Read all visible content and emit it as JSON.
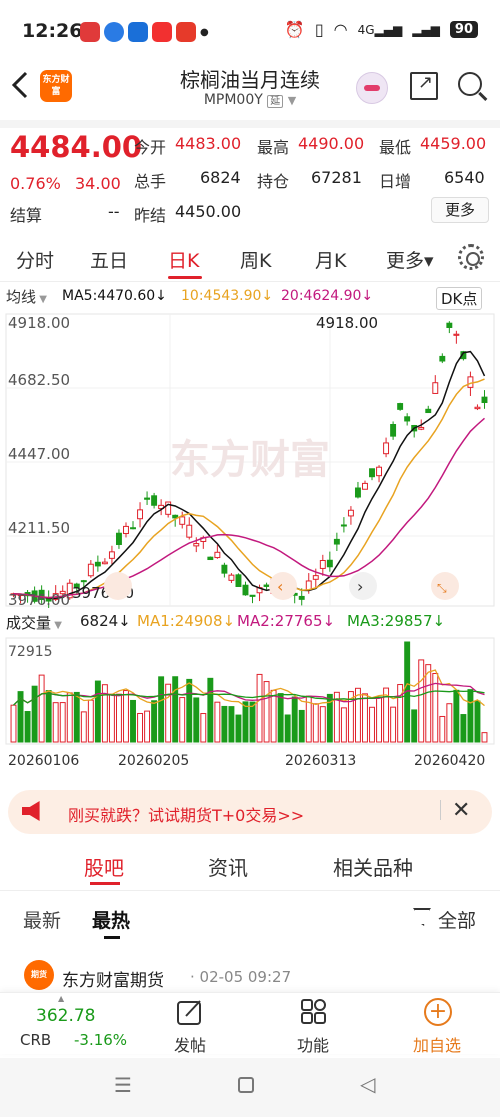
{
  "status": {
    "time": "12:26",
    "battery": "90",
    "network": "4G"
  },
  "header": {
    "brand_logo_text": "东方财富",
    "title": "棕榈油当月连续",
    "code": "MPM00Y",
    "code_tag": "延"
  },
  "quote": {
    "price": "4484.00",
    "change_pct": "0.76%",
    "change": "34.00",
    "open_label": "今开",
    "open": "4483.00",
    "high_label": "最高",
    "high": "4490.00",
    "low_label": "最低",
    "low": "4459.00",
    "volume_label": "总手",
    "volume": "6824",
    "oi_label": "持仓",
    "oi": "67281",
    "daily_inc_label": "日增",
    "daily_inc": "6540",
    "settle_label": "结算",
    "settle": "--",
    "prev_settle_label": "昨结",
    "prev_settle": "4450.00",
    "more_label": "更多"
  },
  "period_tabs": [
    "分时",
    "五日",
    "日K",
    "周K",
    "月K",
    "更多▾"
  ],
  "active_period": "日K",
  "chart_head": {
    "indicator": "均线",
    "ma5": "MA5:4470.60↓",
    "ma10": "10:4543.90↓",
    "ma20": "20:4624.90↓",
    "dk_label": "DK点"
  },
  "volume_head": {
    "indicator": "成交量",
    "vol": "6824↓",
    "ma1": "MA1:24908↓",
    "ma2": "MA2:27765↓",
    "ma3": "MA3:29857↓",
    "vol_max_label": "72915"
  },
  "chart_data": {
    "type": "candlestick",
    "y_ticks": [
      "4918.00",
      "4682.50",
      "4447.00",
      "4211.50",
      "3976.00"
    ],
    "ylim": [
      3976.0,
      4918.0
    ],
    "x_ticks": [
      "20260106",
      "20260205",
      "20260313",
      "20260420"
    ],
    "max_label": "4918.00",
    "min_label": "3976.00",
    "watermark": "东方财富",
    "volume_max": 72915,
    "colors": {
      "up": "#e0212b",
      "down": "#1a9a1a",
      "ma5": "#111111",
      "ma10": "#e8a321",
      "ma20": "#c2197e"
    }
  },
  "promo": {
    "text": "刚买就跌？试试期货T+0交易>>"
  },
  "section_tabs": [
    "股吧",
    "资讯",
    "相关品种"
  ],
  "active_section": "股吧",
  "sub_tabs": [
    "最新",
    "最热"
  ],
  "active_sub_tab": "最热",
  "filter_label": "全部",
  "post": {
    "author": "东方财富期货",
    "time": "· 02-05 09:27",
    "avatar_text": "期货"
  },
  "bottom_bar": {
    "ticker_value": "362.78",
    "ticker_name": "CRB",
    "ticker_pct": "-3.16%",
    "post_label": "发帖",
    "function_label": "功能",
    "add_label": "加自选"
  }
}
